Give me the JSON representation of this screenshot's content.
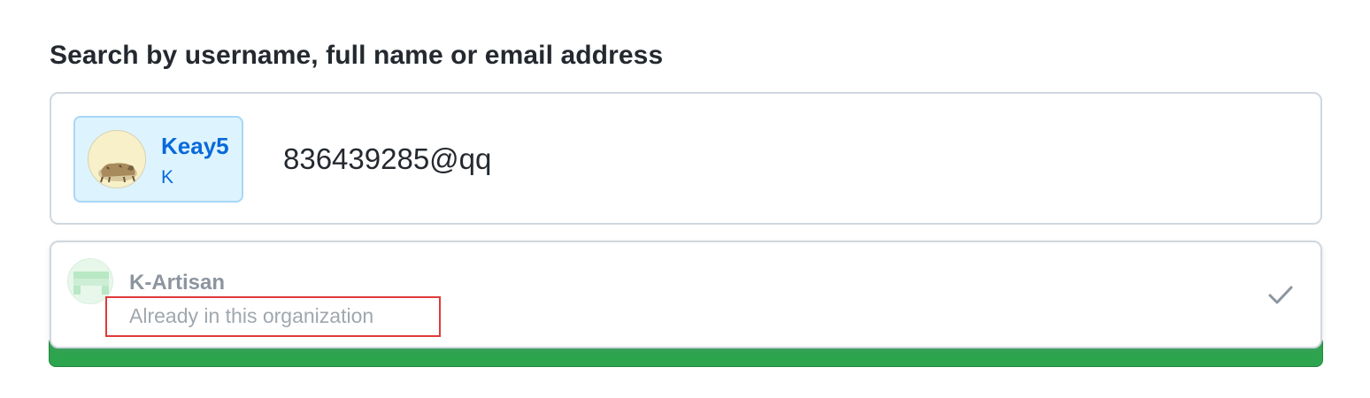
{
  "search": {
    "label": "Search by username, full name or email address",
    "selected_user": {
      "username": "Keay5",
      "name": "K"
    },
    "input_value": "836439285@qq"
  },
  "suggestions": [
    {
      "name": "K-Artisan",
      "status": "Already in this organization",
      "icon": "check-icon"
    }
  ],
  "colors": {
    "chip_bg": "#ddf4ff",
    "link_blue": "#0969da",
    "submit_green": "#2da44e",
    "highlight_red": "#e03a3a"
  }
}
